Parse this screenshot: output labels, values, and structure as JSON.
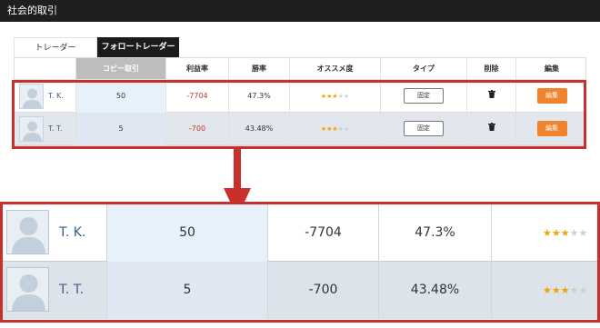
{
  "header": {
    "title": "社会的取引"
  },
  "tabs": [
    {
      "label": "トレーダー",
      "active": false
    },
    {
      "label": "フォロートレーダー",
      "active": true
    }
  ],
  "table": {
    "columns": [
      "",
      "コピー取引",
      "利益率",
      "勝率",
      "オススメ度",
      "タイプ",
      "削除",
      "編集"
    ],
    "rows": [
      {
        "name": "T. K.",
        "copy": "50",
        "profit": "-7704",
        "win_rate": "47.3%",
        "rating": 3,
        "rating_max": 5,
        "type": "固定",
        "edit": "編集"
      },
      {
        "name": "T. T.",
        "copy": "5",
        "profit": "-700",
        "win_rate": "43.48%",
        "rating": 3,
        "rating_max": 5,
        "type": "固定",
        "edit": "編集"
      }
    ]
  },
  "icons": {
    "avatar": "avatar-icon",
    "trash": "trash-icon",
    "star": "star-icon",
    "arrow": "arrow-down-icon"
  },
  "colors": {
    "header_bg": "#1f1f1f",
    "highlight": "#c9302c",
    "negative": "#c0392b",
    "edit_button": "#f0842c",
    "star": "#f0a400"
  }
}
